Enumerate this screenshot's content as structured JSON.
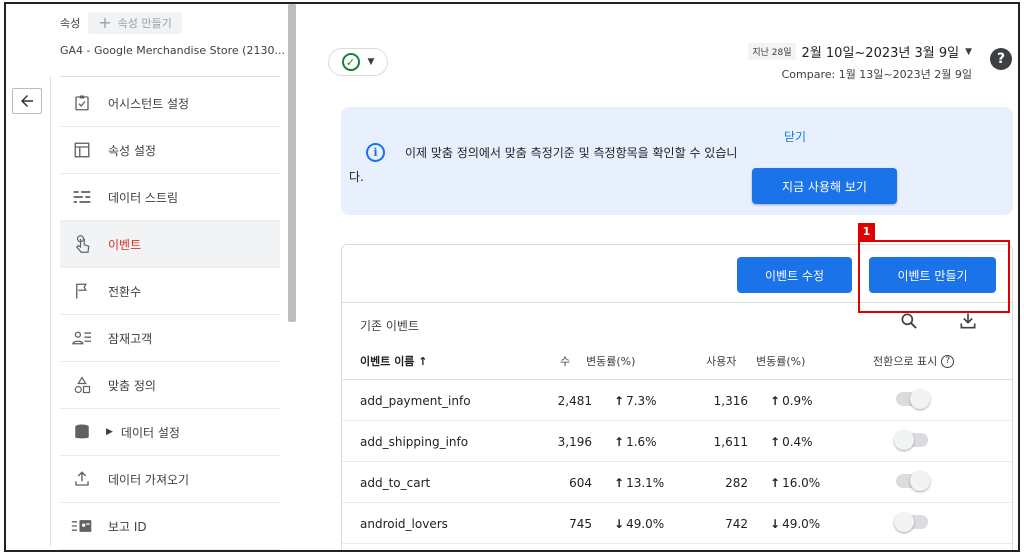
{
  "sidebar": {
    "property_label": "속성",
    "create_property": "속성 만들기",
    "property_name": "GA4 - Google Merchandise Store (2130...",
    "back_icon": "arrow-left-icon",
    "items": [
      {
        "label": "어시스턴트 설정",
        "icon": "clipboard-check-icon"
      },
      {
        "label": "속성 설정",
        "icon": "layout-icon"
      },
      {
        "label": "데이터 스트림",
        "icon": "stream-icon"
      },
      {
        "label": "이벤트",
        "icon": "touch-icon",
        "active": true
      },
      {
        "label": "전환수",
        "icon": "flag-icon"
      },
      {
        "label": "잠재고객",
        "icon": "audience-icon"
      },
      {
        "label": "맞춤 정의",
        "icon": "shapes-icon"
      },
      {
        "label": "데이터 설정",
        "icon": "database-icon"
      },
      {
        "label": "데이터 가져오기",
        "icon": "upload-icon"
      },
      {
        "label": "보고 ID",
        "icon": "report-id-icon"
      }
    ]
  },
  "header": {
    "date_chip": "지난 28일",
    "date_range": "2월 10일~2023년 3월 9일",
    "compare": "Compare: 1월 13일~2023년 2월 9일"
  },
  "banner": {
    "text": "이제 맞춤 정의에서 맞춤 측정기준 및 측정항목을 확인할 수 있습니다.",
    "close": "닫기",
    "try_now": "지금 사용해 보기"
  },
  "card": {
    "edit_event": "이벤트 수정",
    "create_event": "이벤트 만들기",
    "step_number": "1",
    "existing_title": "기존 이벤트",
    "columns": {
      "name": "이벤트 이름 ↑",
      "count": "수",
      "change1": "변동률(%)",
      "users": "사용자",
      "change2": "변동률(%)",
      "conversion": "전환으로 표시",
      "help": "?"
    },
    "rows": [
      {
        "name": "add_payment_info",
        "count": "2,481",
        "chg1_arrow": "↑",
        "chg1": "7.3%",
        "users": "1,316",
        "chg2_arrow": "↑",
        "chg2": "0.9%",
        "conversion": true
      },
      {
        "name": "add_shipping_info",
        "count": "3,196",
        "chg1_arrow": "↑",
        "chg1": "1.6%",
        "users": "1,611",
        "chg2_arrow": "↑",
        "chg2": "0.4%",
        "conversion": false
      },
      {
        "name": "add_to_cart",
        "count": "604",
        "chg1_arrow": "↑",
        "chg1": "13.1%",
        "users": "282",
        "chg2_arrow": "↑",
        "chg2": "16.0%",
        "conversion": true
      },
      {
        "name": "android_lovers",
        "count": "745",
        "chg1_arrow": "↓",
        "chg1": "49.0%",
        "users": "742",
        "chg2_arrow": "↓",
        "chg2": "49.0%",
        "conversion": false
      }
    ]
  },
  "colors": {
    "accent": "#1a73e8",
    "active_nav": "#d93025",
    "positive": "#137333",
    "negative": "#c5221f",
    "highlight": "#e00000"
  }
}
